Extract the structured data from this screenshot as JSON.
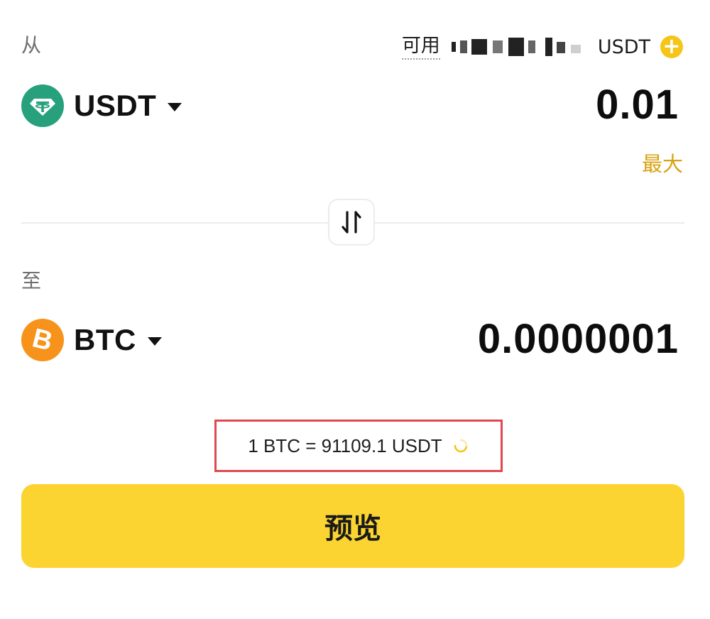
{
  "from": {
    "label": "从",
    "available_label": "可用",
    "available_currency": "USDT",
    "coin": {
      "code": "USDT",
      "icon": "tether-icon",
      "icon_color": "#26a17b"
    },
    "amount": "0.01",
    "max_label": "最大"
  },
  "to": {
    "label": "至",
    "coin": {
      "code": "BTC",
      "icon": "bitcoin-icon",
      "icon_color": "#f7931a"
    },
    "amount": "0.0000001"
  },
  "swap": {
    "icon": "swap-vertical-icon"
  },
  "rate": {
    "text": "1 BTC = 91109.1 USDT",
    "highlight_color": "#e0484f"
  },
  "preview_button": {
    "label": "预览",
    "color": "#fbd431"
  },
  "colors": {
    "accent": "#f5c518",
    "max_link": "#d8a312"
  }
}
